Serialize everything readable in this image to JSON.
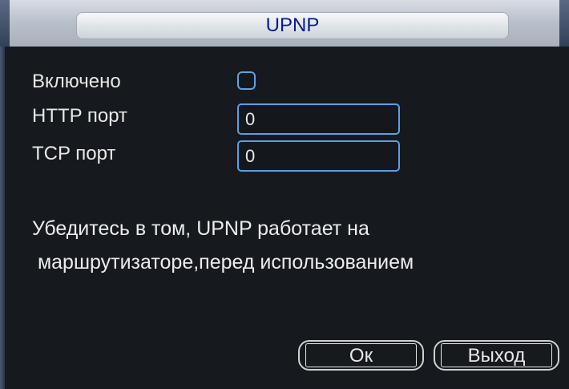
{
  "window": {
    "title": "UPNP"
  },
  "form": {
    "enabled_label": "Включено",
    "enabled_checked": false,
    "http_port_label": "HTTP порт",
    "http_port_value": "0",
    "tcp_port_label": "TCP порт",
    "tcp_port_value": "0"
  },
  "message": {
    "line1": "Убедитесь в том, UPNP работает на",
    "line2": " маршрутизаторе,перед использованием"
  },
  "buttons": {
    "ok_label": "Ок",
    "exit_label": "Выход"
  },
  "colors": {
    "title_text": "#0a1a8c",
    "field_border": "#5a9fe8",
    "background": "#161a1e"
  }
}
